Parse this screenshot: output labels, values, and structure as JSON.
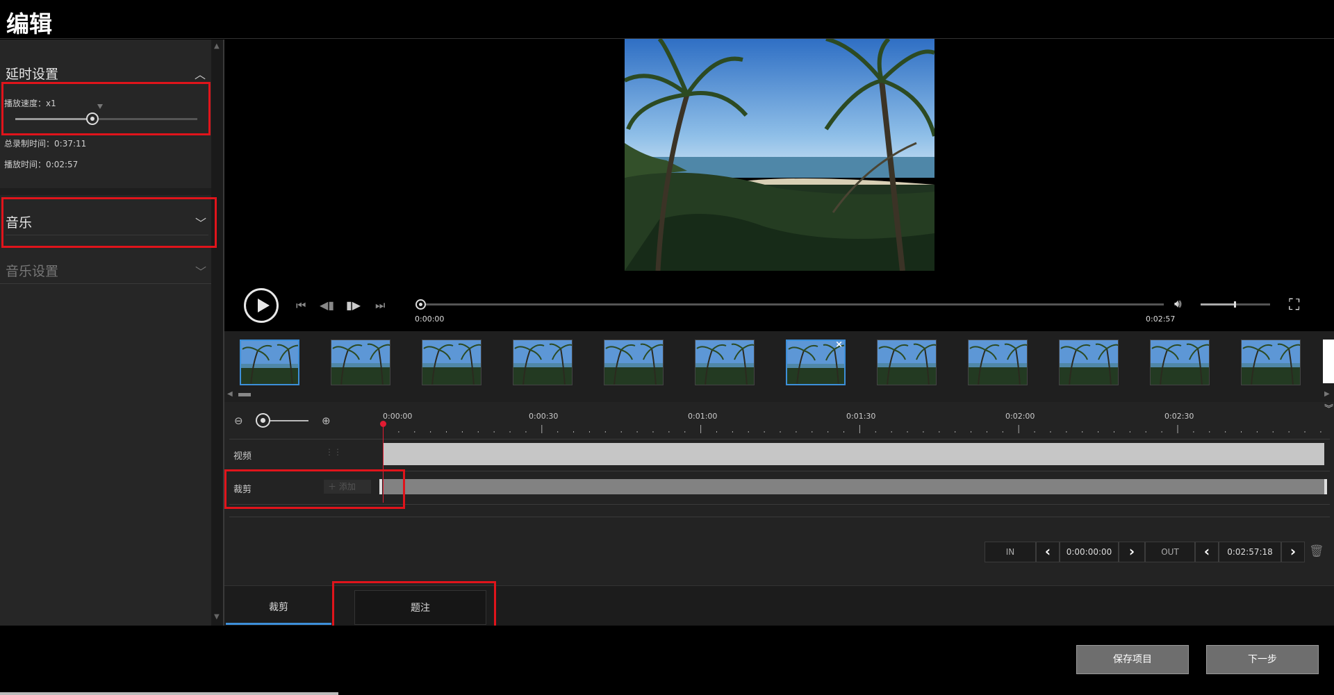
{
  "window": {
    "title": "编辑"
  },
  "left_panel": {
    "timelapse": {
      "title": "延时设置",
      "speed_label": "播放速度：",
      "speed_value": "x1",
      "total_rec_label": "总录制时间：",
      "total_rec_value": "0:37:11",
      "play_time_label": "播放时间：",
      "play_time_value": "0:02:57"
    },
    "music": {
      "title": "音乐"
    },
    "music_settings": {
      "title": "音乐设置"
    }
  },
  "player": {
    "current_time": "0:00:00",
    "total_time": "0:02:57",
    "progress": 0.0,
    "volume": 0.5
  },
  "thumbnails": {
    "count": 12,
    "selected_index": 0,
    "hover_index": 6
  },
  "timeline": {
    "ruler_labels": [
      "0:00:00",
      "0:00:30",
      "0:01:00",
      "0:01:30",
      "0:02:00",
      "0:02:30"
    ],
    "tracks": {
      "video_label": "视频",
      "clip_label": "裁剪",
      "add_label": "添加"
    }
  },
  "inout": {
    "in_label": "IN",
    "in_value": "0:00:00:00",
    "out_label": "OUT",
    "out_value": "0:02:57:18"
  },
  "tabs": [
    {
      "label": "裁剪",
      "active": true
    },
    {
      "label": "题注",
      "active": false
    }
  ],
  "footer": {
    "save_label": "保存项目",
    "next_label": "下一步"
  },
  "colors": {
    "accent": "#3d8fd9",
    "highlight": "#e0141b",
    "playhead": "#e21b32"
  }
}
